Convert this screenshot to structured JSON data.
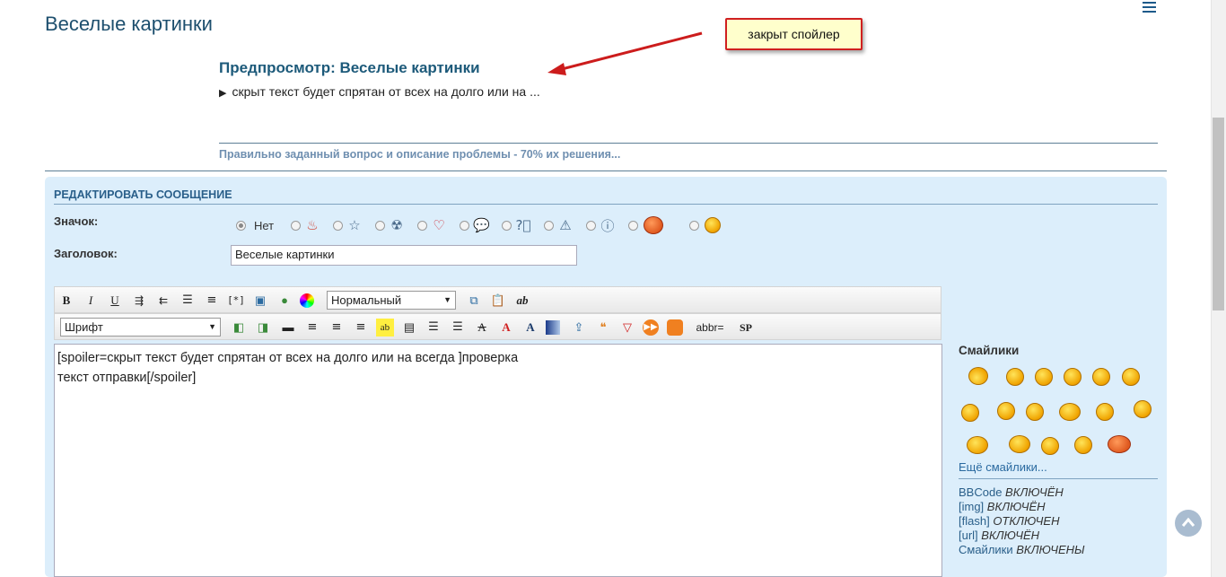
{
  "page": {
    "title": "Веселые картинки"
  },
  "annotation": {
    "text": "закрыт спойлер"
  },
  "preview": {
    "title": "Предпросмотр: Веселые картинки",
    "spoiler_text": "скрыт текст будет спрятан от всех на долго или на ...",
    "signature": "Правильно заданный вопрос и описание проблемы - 70% их решения..."
  },
  "editor": {
    "heading": "РЕДАКТИРОВАТЬ СООБЩЕНИЕ",
    "icon_label": "Значок:",
    "icon_none_label": "Нет",
    "title_label": "Заголовок:",
    "title_value": "Веселые картинки",
    "format_select": "Нормальный",
    "font_select": "Шрифт",
    "abbr_label": "abbr=",
    "sp_label": "SP",
    "body_text": "[spoiler=скрыт текст будет спрятан от всех на долго или на всегда ]проверка\nтекст отправки[/spoiler]"
  },
  "smilies": {
    "title": "Смайлики",
    "more_link": "Ещё смайлики...",
    "status": [
      {
        "name": "BBCode",
        "state": "ВКЛЮЧЁН"
      },
      {
        "name": "[img]",
        "state": "ВКЛЮЧЁН"
      },
      {
        "name": "[flash]",
        "state": "ОТКЛЮЧЕН"
      },
      {
        "name": "[url]",
        "state": "ВКЛЮЧЁН"
      },
      {
        "name": "Смайлики",
        "state": "ВКЛЮЧЕНЫ"
      }
    ]
  },
  "icons": {
    "menu": "hamburger-icon",
    "scroll_top": "chevron-up-icon"
  },
  "colors": {
    "accent": "#1d5a7a",
    "panel_bg": "#dceefb",
    "annotation_border": "#d02020",
    "annotation_bg": "#ffffcc"
  }
}
